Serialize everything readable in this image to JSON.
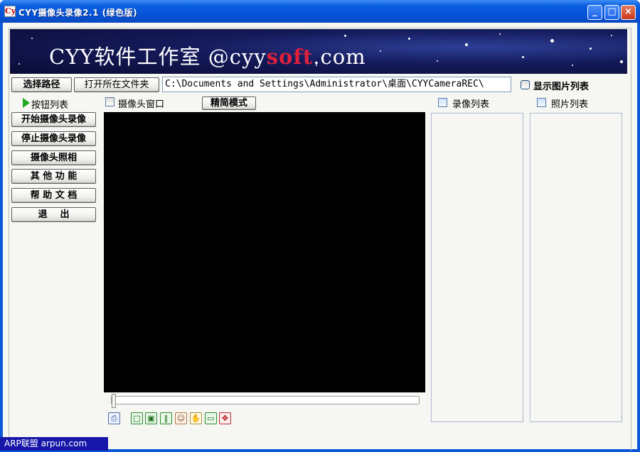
{
  "window": {
    "title": "CYY摄像头录像2.1 (绿色版)",
    "app_icon_text": "Cy",
    "minimize": "_",
    "maximize": "□",
    "close": "×"
  },
  "banner": {
    "text_main": "CYY软件工作室 @cyy",
    "text_accent": "soft",
    "text_tail": ".com"
  },
  "toolbar": {
    "select_path": "选择路径",
    "open_folder": "打开所在文件夹",
    "path_value": "C:\\Documents and Settings\\Administrator\\桌面\\CYYCameraREC\\",
    "show_image_list": "显示图片列表"
  },
  "sidebar": {
    "header": "按钮列表",
    "buttons": [
      "开始摄像头录像",
      "停止摄像头录像",
      "摄像头照相",
      "其 他 功 能",
      "帮 助 文 档",
      "退    出"
    ]
  },
  "camera": {
    "label": "摄像头窗口",
    "simple_mode": "精简模式"
  },
  "lists": {
    "video_list": "录像列表",
    "photo_list": "照片列表"
  },
  "footer": {
    "link": "ARP联盟 arpun.com"
  },
  "colors": {
    "titlebar": "#0552d6",
    "client_bg": "#f6f7f3",
    "video_bg": "#000000",
    "footer_bg": "#1616a8",
    "banner_accent": "#e0203a"
  },
  "icons": [
    "camera-save-icon",
    "square-icon",
    "image-icon",
    "columns-icon",
    "person-icon",
    "hand-icon",
    "monitor-icon",
    "move-icon"
  ]
}
